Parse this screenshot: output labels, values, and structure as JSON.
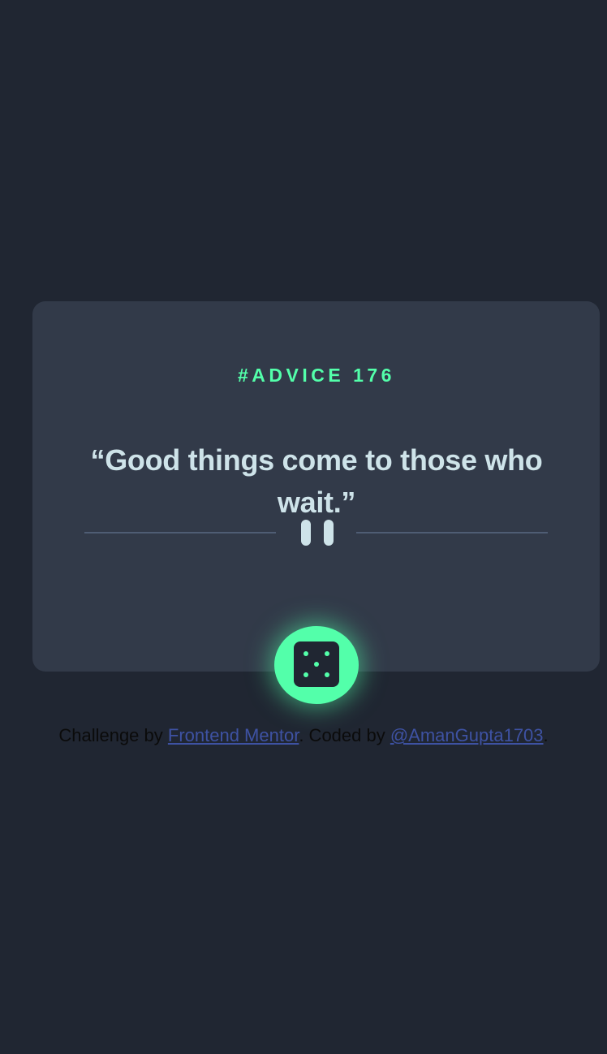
{
  "advice": {
    "id_label": "#ADVICE 176",
    "quote": "“Good things come to those who wait.”"
  },
  "button": {
    "icon": "dice-icon"
  },
  "divider": {
    "icon": "pause-icon"
  },
  "attribution": {
    "prefix": "Challenge by ",
    "link1_text": "Frontend Mentor",
    "middle": ". Coded by ",
    "link2_text": "@AmanGupta1703",
    "suffix": "."
  },
  "colors": {
    "background": "#202632",
    "card": "#323a49",
    "accent": "#53ffaa",
    "text": "#cee3e9",
    "divider": "#4f5d74",
    "link": "#3e52a3"
  }
}
